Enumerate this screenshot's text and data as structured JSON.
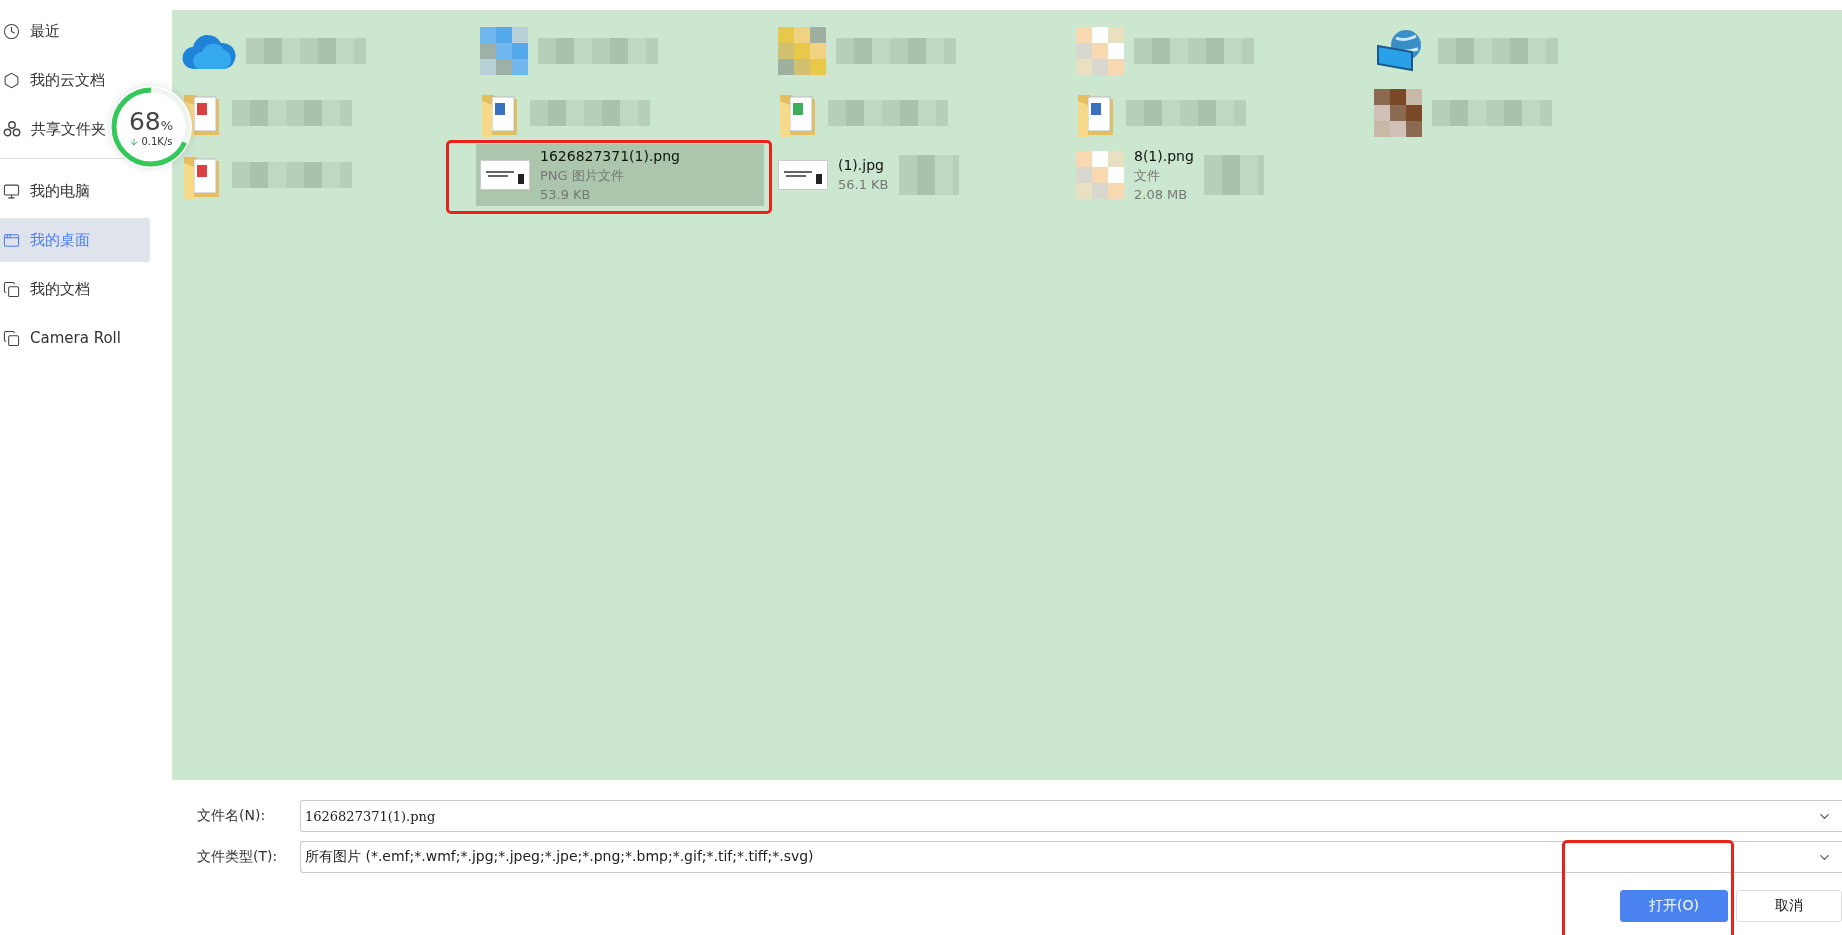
{
  "sidebar": {
    "groups": [
      [
        {
          "label": "最近",
          "selected": false
        },
        {
          "label": "我的云文档",
          "selected": false
        },
        {
          "label": "共享文件夹",
          "selected": false
        }
      ],
      [
        {
          "label": "我的电脑",
          "selected": false
        },
        {
          "label": "我的桌面",
          "selected": true
        },
        {
          "label": "我的文档",
          "selected": false
        },
        {
          "label": "Camera Roll",
          "selected": false
        }
      ]
    ]
  },
  "speed_widget": {
    "percent": "68",
    "unit": "%",
    "speed": "0.1K/s"
  },
  "files": [
    {
      "kind": "cloud",
      "blurred": true,
      "selected": false,
      "annotated": false
    },
    {
      "kind": "mosaic",
      "blurred": true,
      "selected": false,
      "annotated": false
    },
    {
      "kind": "mosaic",
      "blurred": true,
      "selected": false,
      "annotated": false
    },
    {
      "kind": "mosaic",
      "blurred": true,
      "selected": false,
      "annotated": false
    },
    {
      "kind": "network",
      "blurred": true,
      "selected": false,
      "annotated": false
    },
    {
      "kind": "folder",
      "blurred": true,
      "selected": false,
      "annotated": false
    },
    {
      "kind": "folder",
      "blurred": true,
      "selected": false,
      "annotated": false
    },
    {
      "kind": "folder",
      "blurred": true,
      "selected": false,
      "annotated": false
    },
    {
      "kind": "folder",
      "blurred": true,
      "selected": false,
      "annotated": false
    },
    {
      "kind": "mosaic",
      "blurred": true,
      "selected": false,
      "annotated": false
    },
    {
      "kind": "folder",
      "blurred": true,
      "selected": false,
      "annotated": false
    },
    {
      "kind": "image",
      "name": "1626827371(1).png",
      "type": "PNG 图片文件",
      "size": "53.9 KB",
      "blurred": false,
      "selected": true,
      "annotated": true
    },
    {
      "kind": "image",
      "name": "(1).jpg",
      "size": "56.1 KB",
      "blurred": true,
      "selected": false,
      "annotated": false
    },
    {
      "kind": "mosaic",
      "name": "8(1).png",
      "type": "文件",
      "size": "2.08 MB",
      "blurred": true,
      "selected": false,
      "annotated": false
    }
  ],
  "file_name": {
    "label": "文件名(N):",
    "value": "1626827371(1).png"
  },
  "file_type": {
    "label": "文件类型(T):",
    "value": "所有图片 (*.emf;*.wmf;*.jpg;*.jpeg;*.jpe;*.png;*.bmp;*.gif;*.tif;*.tiff;*.svg)"
  },
  "buttons": [
    {
      "label": "打开(O)",
      "kind": "primary",
      "annotated": true
    },
    {
      "label": "取消",
      "kind": "secondary",
      "annotated": false
    }
  ]
}
